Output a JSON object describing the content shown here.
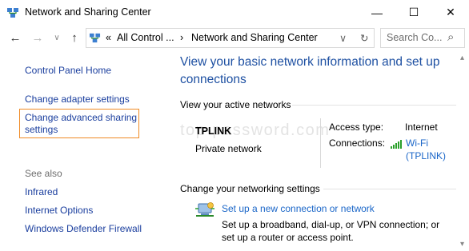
{
  "window": {
    "title": "Network and Sharing Center",
    "minimize_glyph": "—",
    "maximize_glyph": "☐",
    "close_glyph": "✕"
  },
  "toolbar": {
    "back_glyph": "←",
    "forward_glyph": "→",
    "dropdown_glyph": "∨",
    "up_glyph": "↑",
    "breadcrumb_overflow": "«",
    "breadcrumb_parent": "All Control ...",
    "breadcrumb_separator": "›",
    "breadcrumb_current": "Network and Sharing Center",
    "refresh_glyph": "↻",
    "search_placeholder": "Search Co...",
    "search_glyph": "⌕"
  },
  "sidebar": {
    "control_panel_home": "Control Panel Home",
    "change_adapter": "Change adapter settings",
    "change_advanced_line1": "Change advanced sharing",
    "change_advanced_line2": "settings",
    "see_also": "See also",
    "infrared": "Infrared",
    "internet_options": "Internet Options",
    "firewall": "Windows Defender Firewall"
  },
  "main": {
    "heading": "View your basic network information and set up connections",
    "active_networks_title": "View your active networks",
    "network_name": "TPLINK",
    "network_type": "Private network",
    "access_type_label": "Access type:",
    "access_type_value": "Internet",
    "connections_label": "Connections:",
    "connection_link_line1": "Wi-Fi",
    "connection_link_line2": "(TPLINK)",
    "watermark": "top-password.com",
    "change_settings_title": "Change your networking settings",
    "setup_link": "Set up a new connection or network",
    "setup_desc_line1": "Set up a broadband, dial-up, or VPN connection; or",
    "setup_desc_line2": "set up a router or access point."
  },
  "scrollbar": {
    "up_glyph": "▴",
    "down_glyph": "▾"
  },
  "colors": {
    "link_dark": "#1a3e9e",
    "link_blue": "#1a66c8",
    "heading_blue": "#1e50a2",
    "highlight_orange": "#f08a24",
    "signal_green": "#2aa02a"
  },
  "icons": {
    "title": "network-center-icon",
    "address": "network-center-icon",
    "signal": "wifi-signal-icon",
    "setup": "new-connection-icon"
  }
}
